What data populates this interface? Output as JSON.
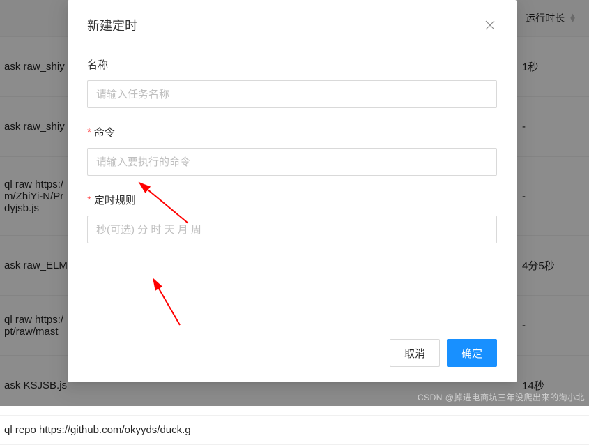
{
  "header": {
    "col_duration": "运行时长"
  },
  "rows": [
    {
      "left": "ask raw_shiy",
      "right": "1秒"
    },
    {
      "left": "ask raw_shiy",
      "right": "-"
    },
    {
      "left": "ql raw https:/\nm/ZhiYi-N/Pr\ndyjsb.js",
      "right": "-"
    },
    {
      "left": "ask raw_ELM",
      "right": "4分5秒"
    },
    {
      "left": "ql raw https:/\npt/raw/mast",
      "right": "-"
    },
    {
      "left": "ask KSJSB.js",
      "right": "14秒"
    },
    {
      "left": "ql repo https://github.com/okyyds/duck.g",
      "right": ""
    }
  ],
  "modal": {
    "title": "新建定时",
    "fields": {
      "name_label": "名称",
      "name_placeholder": "请输入任务名称",
      "command_label": "命令",
      "command_placeholder": "请输入要执行的命令",
      "schedule_label": "定时规则",
      "schedule_placeholder": "秒(可选) 分 时 天 月 周"
    },
    "buttons": {
      "cancel": "取消",
      "ok": "确定"
    }
  },
  "watermark": "CSDN @掉进电商坑三年没爬出来的淘小北"
}
